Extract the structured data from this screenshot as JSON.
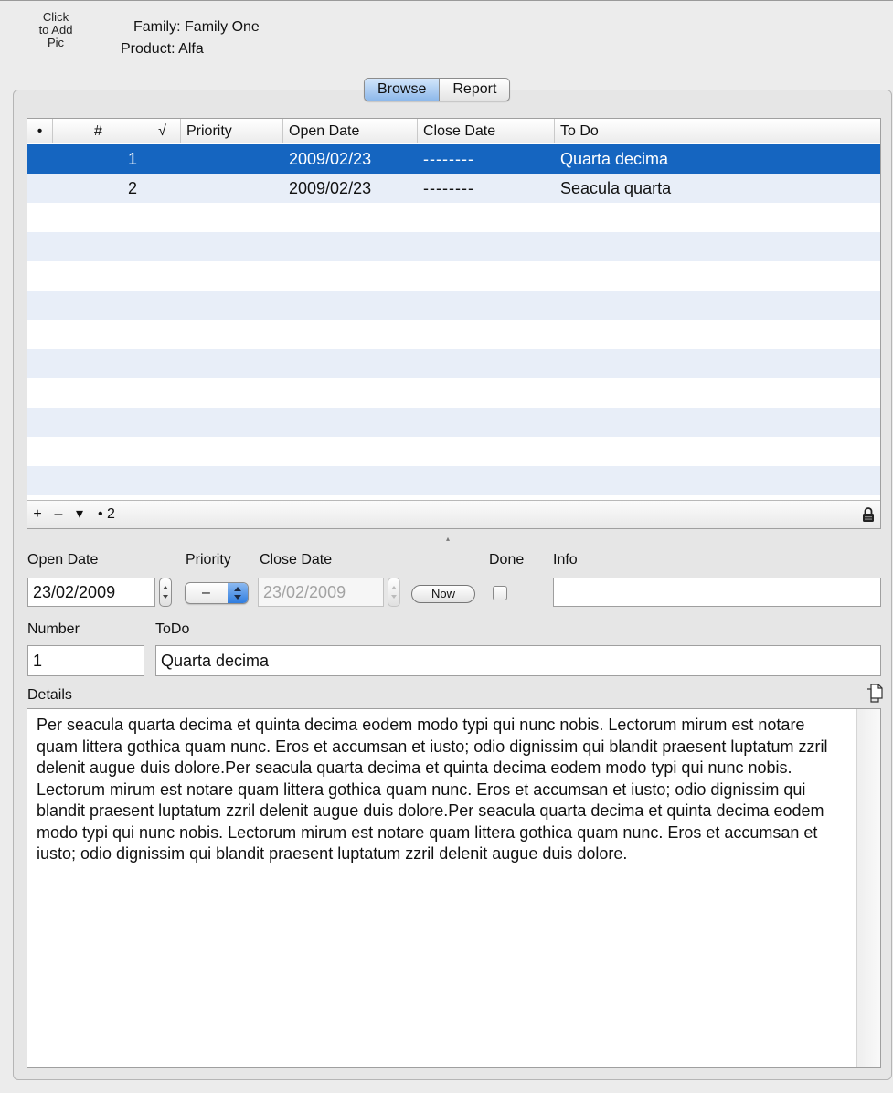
{
  "header": {
    "pic_lines": [
      "Click",
      "to Add",
      "Pic"
    ],
    "family_label": "Family:",
    "family_value": "Family One",
    "product_label": "Product:",
    "product_value": "Alfa"
  },
  "tabs": [
    "Browse",
    "Report"
  ],
  "table": {
    "headers": {
      "dot": "•",
      "number": "#",
      "check": "√",
      "priority": "Priority",
      "open_date": "Open Date",
      "close_date": "Close Date",
      "todo": "To Do"
    },
    "rows": [
      {
        "number": "1",
        "check": "",
        "priority": "",
        "open_date": "2009/02/23",
        "close_date": "--------",
        "todo": "Quarta decima"
      },
      {
        "number": "2",
        "check": "",
        "priority": "",
        "open_date": "2009/02/23",
        "close_date": "--------",
        "todo": "Seacula quarta"
      }
    ],
    "footer": {
      "add": "+",
      "remove": "–",
      "menu": "▾",
      "count": "• 2"
    }
  },
  "form": {
    "open_date_label": "Open Date",
    "open_date_value": "23/02/2009",
    "priority_label": "Priority",
    "priority_value": "–",
    "close_date_label": "Close Date",
    "close_date_value": "23/02/2009",
    "now_label": "Now",
    "done_label": "Done",
    "info_label": "Info",
    "info_value": "",
    "number_label": "Number",
    "number_value": "1",
    "todo_label": "ToDo",
    "todo_value": "Quarta decima",
    "details_label": "Details",
    "details_value": "Per seacula quarta decima et quinta decima eodem modo typi qui nunc nobis. Lectorum mirum est notare quam littera gothica quam nunc. Eros et accumsan et iusto; odio dignissim qui blandit praesent luptatum zzril delenit augue duis dolore.Per seacula quarta decima et quinta decima eodem modo typi qui nunc nobis. Lectorum mirum est notare quam littera gothica quam nunc. Eros et accumsan et iusto; odio dignissim qui blandit praesent luptatum zzril delenit augue duis dolore.Per seacula quarta decima et quinta decima eodem modo typi qui nunc nobis. Lectorum mirum est notare quam littera gothica quam nunc. Eros et accumsan et iusto; odio dignissim qui blandit praesent luptatum zzril delenit augue duis dolore."
  },
  "colors": {
    "selection": "#1565c0",
    "alt_row": "#e8eef8",
    "window_bg": "#ececec"
  },
  "icons": [
    "lock-icon",
    "copy-icon",
    "resize-handle-icon"
  ]
}
